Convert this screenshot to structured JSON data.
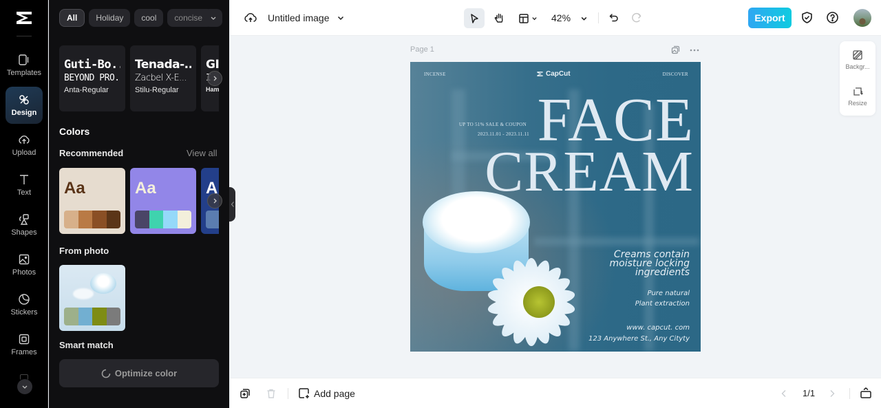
{
  "rail": {
    "items": [
      {
        "label": "Templates",
        "icon": "templates-icon"
      },
      {
        "label": "Design",
        "icon": "design-icon",
        "active": true
      },
      {
        "label": "Upload",
        "icon": "upload-icon"
      },
      {
        "label": "Text",
        "icon": "text-icon"
      },
      {
        "label": "Shapes",
        "icon": "shapes-icon"
      },
      {
        "label": "Photos",
        "icon": "photos-icon"
      },
      {
        "label": "Stickers",
        "icon": "stickers-icon"
      },
      {
        "label": "Frames",
        "icon": "frames-icon"
      }
    ]
  },
  "panel": {
    "chips": [
      "All",
      "Holiday",
      "cool",
      "concise"
    ],
    "font_cards": [
      {
        "line1": "Guti-Bo...",
        "line2": "BEYOND PRO...",
        "line3": "Anta-Regular"
      },
      {
        "line1": "Tenada-...",
        "line2": "Zacbel X-E...",
        "line3": "Stilu-Regular"
      },
      {
        "line1": "GI",
        "line2": "I",
        "line3": "Ham"
      }
    ],
    "colors_title": "Colors",
    "recommended_label": "Recommended",
    "view_all_label": "View all",
    "palettes": [
      {
        "sample": "Aa",
        "bg": "#e6dccf",
        "text_color": "#5a3418",
        "swatches": [
          "#d7b08a",
          "#b97a45",
          "#8a4f25",
          "#5b3518"
        ]
      },
      {
        "sample": "Aa",
        "bg": "#9286e8",
        "text_color": "#f3efdb",
        "swatches": [
          "#4a4566",
          "#3fd3ae",
          "#95d9f9",
          "#f3efdb"
        ]
      },
      {
        "sample": "A",
        "bg": "#233f8a",
        "text_color": "#ffffff",
        "swatches": [
          "#5b7db0"
        ]
      }
    ],
    "from_photo_label": "From photo",
    "photo_swatches": [
      "#9db08a",
      "#72afd1",
      "#7e8c14",
      "#7b7b7b"
    ],
    "smart_match_label": "Smart match",
    "optimize_label": "Optimize color"
  },
  "topbar": {
    "title": "Untitled image",
    "zoom": "42%",
    "export_label": "Export"
  },
  "canvas": {
    "page_label": "Page 1",
    "artboard": {
      "top_left": "INCENSE",
      "brand": "CapCut",
      "top_right": "DISCOVER",
      "sale": "UP TO 51% SALE & COUPON",
      "dates": "2023.11.01 - 2023.11.11",
      "headline1": "FACE",
      "headline2": "CREAM",
      "tagline1": "Creams contain",
      "tagline2": "moisture locking",
      "tagline3": "ingredients",
      "feature1": "Pure natural",
      "feature2": "Plant extraction",
      "website": "www. capcut. com",
      "address": "123 Anywhere St., Any Cityty"
    }
  },
  "side_tools": [
    {
      "label": "Backgr..."
    },
    {
      "label": "Resize"
    }
  ],
  "bottombar": {
    "add_page_label": "Add page",
    "pager": "1/1"
  }
}
